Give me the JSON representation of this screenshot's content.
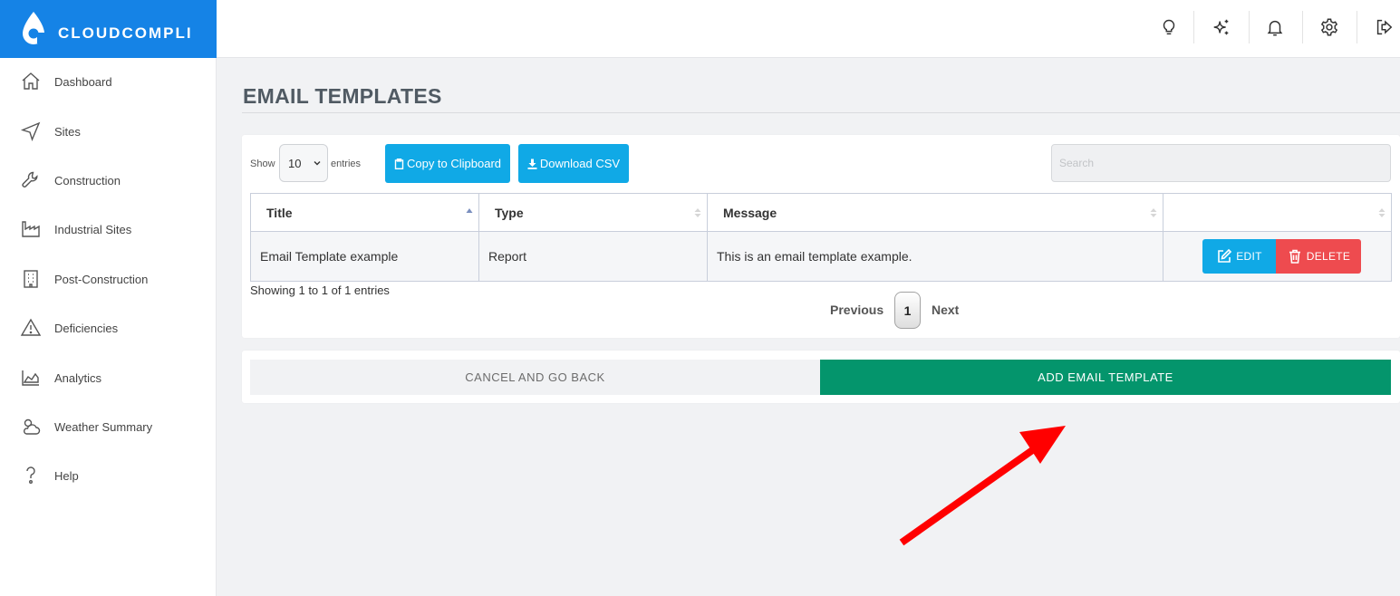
{
  "app": {
    "brand_name": "CLOUDCOMPLI",
    "brand_color": "#1583e6"
  },
  "sidebar": {
    "items": [
      {
        "label": "Dashboard",
        "icon": "home-icon"
      },
      {
        "label": "Sites",
        "icon": "navigation-arrow-icon"
      },
      {
        "label": "Construction",
        "icon": "wrench-icon"
      },
      {
        "label": "Industrial Sites",
        "icon": "factory-icon"
      },
      {
        "label": "Post-Construction",
        "icon": "building-icon"
      },
      {
        "label": "Deficiencies",
        "icon": "warning-icon"
      },
      {
        "label": "Analytics",
        "icon": "area-chart-icon"
      },
      {
        "label": "Weather Summary",
        "icon": "weather-icon"
      },
      {
        "label": "Help",
        "icon": "help-icon"
      }
    ]
  },
  "topbar": {
    "icons": [
      "lightbulb-icon",
      "sparkles-icon",
      "bell-icon",
      "gear-icon",
      "logout-icon"
    ]
  },
  "page": {
    "title": "EMAIL TEMPLATES"
  },
  "table_controls": {
    "show_label": "Show",
    "entries_label": "entries",
    "page_length": "10",
    "copy_label": "Copy to Clipboard",
    "csv_label": "Download CSV",
    "search_placeholder": "Search"
  },
  "table": {
    "columns": [
      "Title",
      "Type",
      "Message",
      ""
    ],
    "rows": [
      {
        "title": "Email Template example",
        "type": "Report",
        "message": "This is an email template example.",
        "edit_label": "EDIT",
        "delete_label": "DELETE"
      }
    ],
    "info": "Showing 1 to 1 of 1 entries",
    "pagination": {
      "previous": "Previous",
      "current": "1",
      "next": "Next"
    }
  },
  "actions": {
    "cancel_label": "CANCEL AND GO BACK",
    "add_label": "ADD EMAIL TEMPLATE",
    "add_color": "#04956c"
  },
  "annotation": {
    "arrow_color": "#ff0000"
  }
}
